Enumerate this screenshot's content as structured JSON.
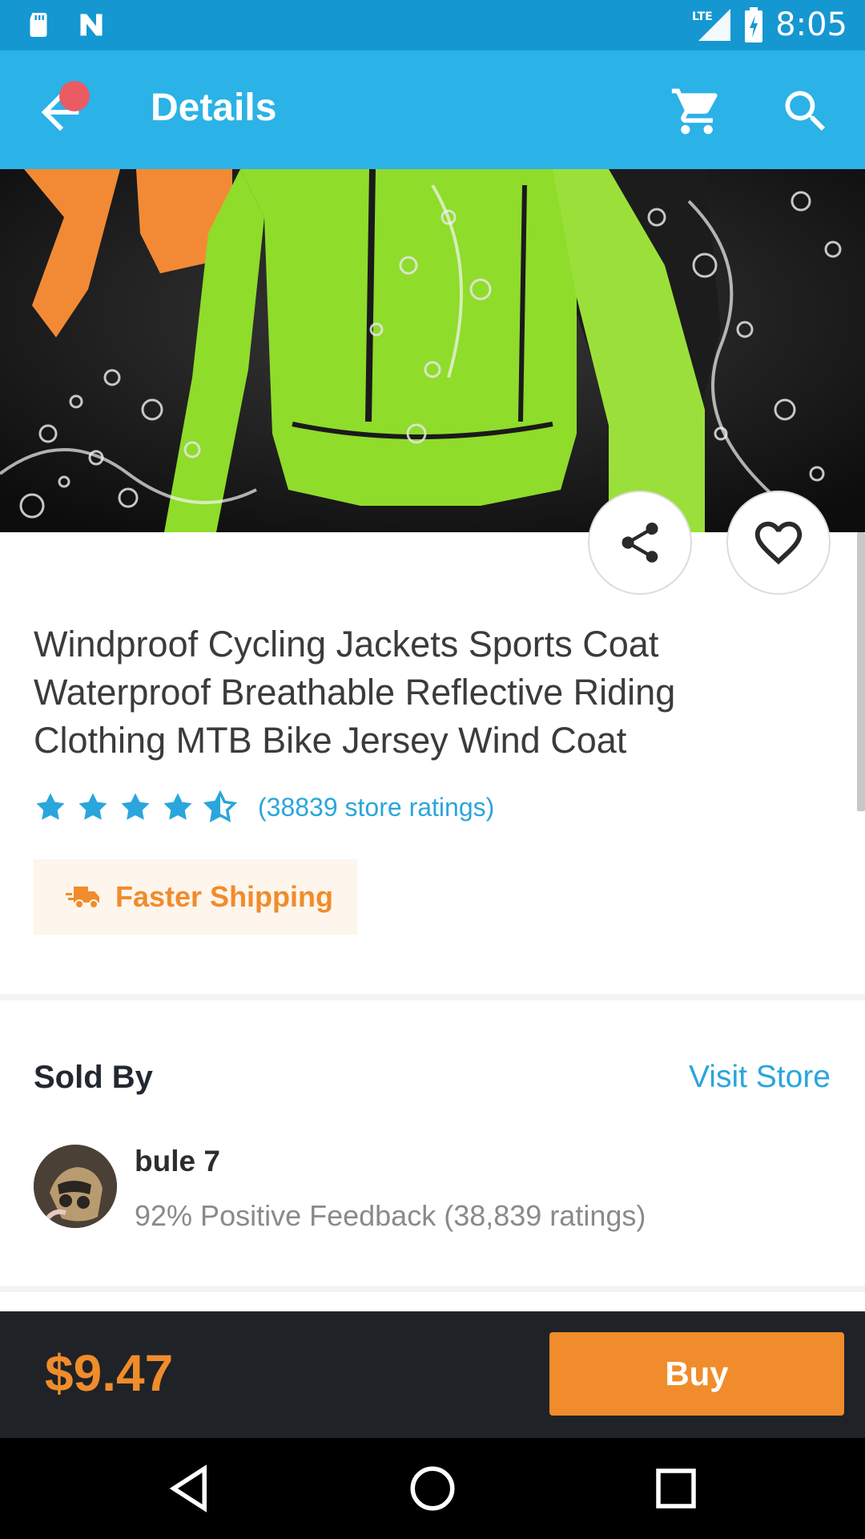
{
  "status_bar": {
    "time": "8:05",
    "network": "LTE",
    "icons": [
      "sd-card-icon",
      "notification-n-icon",
      "lte-signal-icon",
      "battery-charging-icon"
    ]
  },
  "app_bar": {
    "title": "Details",
    "icons": [
      "back-arrow-icon",
      "cart-icon",
      "search-icon"
    ]
  },
  "product": {
    "title": "Windproof Cycling Jackets Sports Coat Waterproof Breathable Reflective Riding Clothing MTB Bike Jersey Wind Coat",
    "rating": 4.5,
    "ratings_text": "(38839 store ratings)",
    "shipping_label": "Faster Shipping"
  },
  "seller": {
    "section_label": "Sold By",
    "visit_store_label": "Visit Store",
    "name": "bule 7",
    "feedback": "92% Positive Feedback (38,839 ratings)"
  },
  "buy_bar": {
    "price": "$9.47",
    "buy_label": "Buy"
  },
  "colors": {
    "status_bar": "#1597d2",
    "app_bar": "#2bb2e6",
    "accent_blue": "#2aa6dc",
    "accent_orange": "#f08c2b",
    "buy_bar": "#1f2327"
  }
}
